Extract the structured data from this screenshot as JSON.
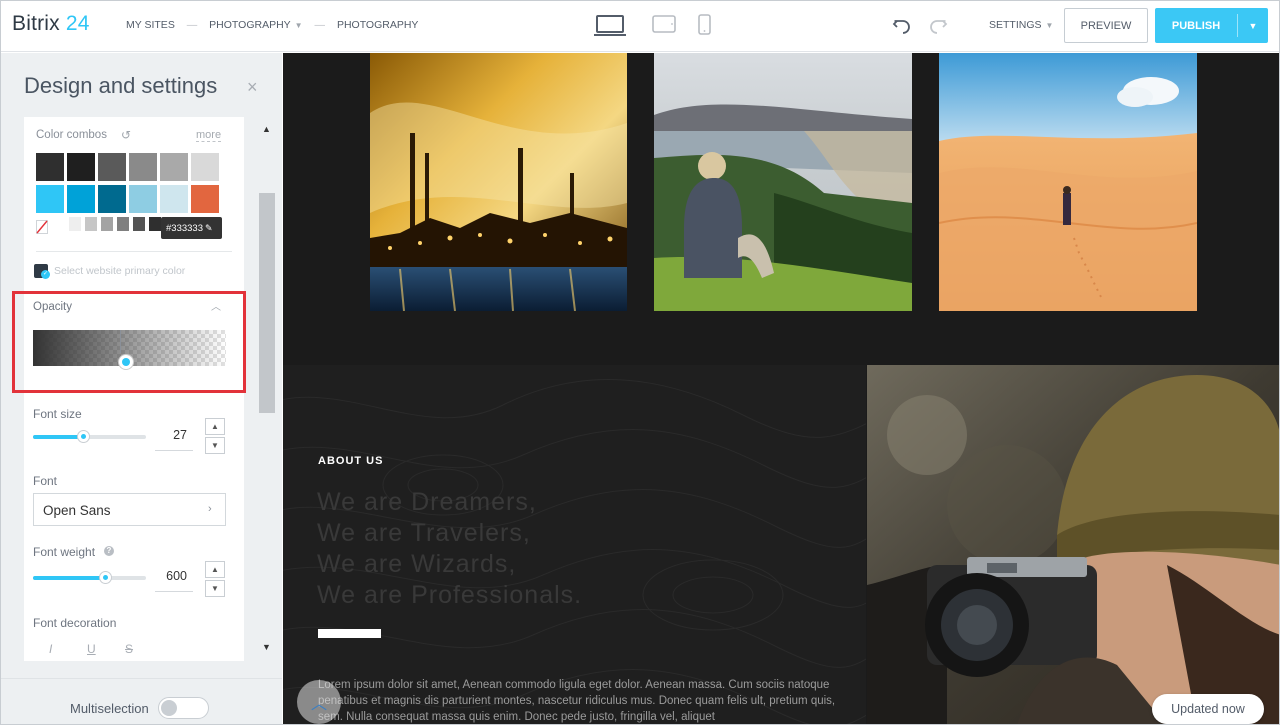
{
  "app": {
    "logo_main": "Bitrix",
    "logo_num": "24"
  },
  "breadcrumb": {
    "items": [
      "MY SITES",
      "PHOTOGRAPHY",
      "PHOTOGRAPHY"
    ],
    "separator": "—"
  },
  "toolbar": {
    "settings_label": "SETTINGS",
    "preview_label": "PREVIEW",
    "publish_label": "PUBLISH",
    "devices": [
      "desktop-icon",
      "tablet-icon",
      "mobile-icon"
    ],
    "active_device": "desktop",
    "accent_color": "#3bc8f5"
  },
  "panel": {
    "title": "Design and settings",
    "close_glyph": "×",
    "color_combos_label": "Color combos",
    "more_label": "more",
    "swatches_row1": [
      "#2f2f2f",
      "#1f1f1f",
      "#5a5a5a",
      "#8a8a8a",
      "#a9a9a9",
      "#d9d9d9"
    ],
    "swatches_row2": [
      "#2fc6f6",
      "#00a2d8",
      "#006a8f",
      "#8ecde3",
      "#cfe6ee",
      "#e2663f"
    ],
    "mini_swatches": [
      "#ffffff",
      "#eeeeee",
      "#c6c6c6",
      "#a3a3a3",
      "#7f7f7f",
      "#545454",
      "#2f2f2f",
      "#0a0a0a"
    ],
    "selected_color": "#333333",
    "primary_color_label": "Select website primary color",
    "opacity_label": "Opacity",
    "opacity_value": 0.48,
    "font_size_label": "Font size",
    "font_size_value": "27",
    "font_size_fraction": 0.44,
    "font_label": "Font",
    "font_value": "Open Sans",
    "font_weight_label": "Font weight",
    "font_weight_value": "600",
    "font_weight_fraction": 0.64,
    "font_decoration_label": "Font decoration",
    "decorations": [
      "I",
      "U",
      "S"
    ],
    "multiselection_label": "Multiselection"
  },
  "canvas": {
    "about_title": "ABOUT US",
    "about_lines": [
      "We are Dreamers,",
      "We are Travelers,",
      "We are Wizards,",
      "We are Professionals."
    ],
    "about_text": "Lorem ipsum dolor sit amet, Aenean commodo ligula eget dolor. Aenean massa. Cum sociis natoque penatibus et magnis dis parturient montes, nascetur ridiculus mus. Donec quam felis ult, pretium quis, sem. Nulla consequat massa quis enim. Donec pede justo, fringilla vel, aliquet",
    "updated_label": "Updated now"
  }
}
